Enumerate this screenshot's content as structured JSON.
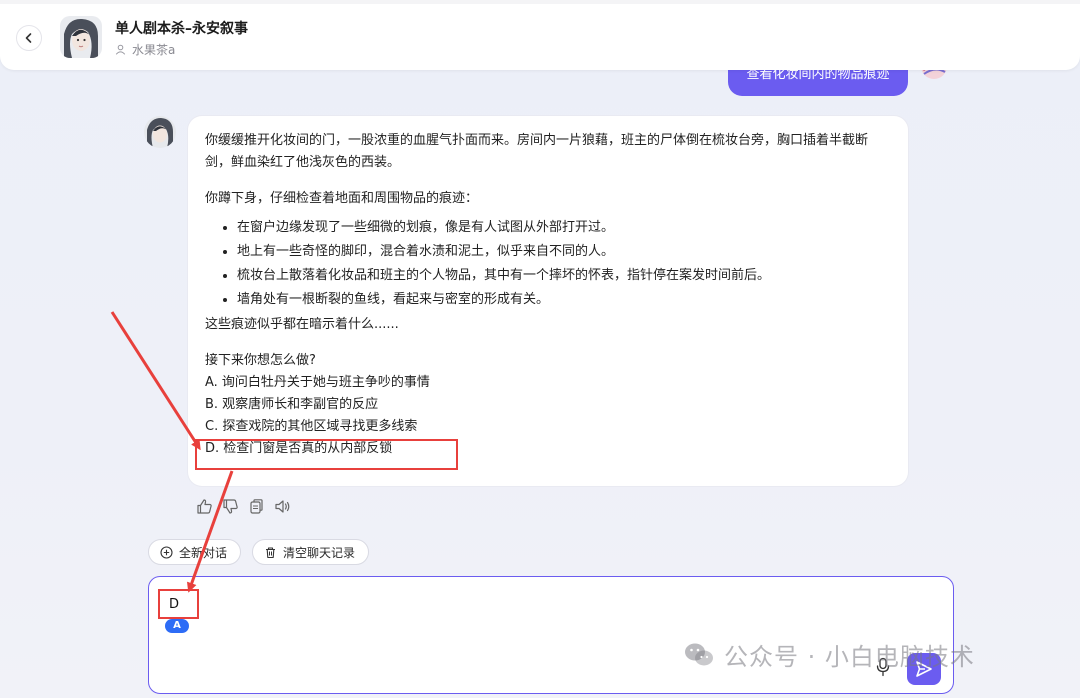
{
  "header": {
    "title": "单人剧本杀–永安叙事",
    "author": "水果茶a"
  },
  "chat": {
    "user_message": "查看化妆间内的物品痕迹",
    "bot_message": {
      "paragraph1": "你缓缓推开化妆间的门，一股浓重的血腥气扑面而来。房间内一片狼藉，班主的尸体倒在梳妆台旁，胸口插着半截断剑，鲜血染红了他浅灰色的西装。",
      "paragraph2": "你蹲下身，仔细检查着地面和周围物品的痕迹：",
      "clues": [
        "在窗户边缘发现了一些细微的划痕，像是有人试图从外部打开过。",
        "地上有一些奇怪的脚印，混合着水渍和泥土，似乎来自不同的人。",
        "梳妆台上散落着化妆品和班主的个人物品，其中有一个摔坏的怀表，指针停在案发时间前后。",
        "墙角处有一根断裂的鱼线，看起来与密室的形成有关。"
      ],
      "paragraph3": "这些痕迹似乎都在暗示着什么......",
      "prompt": "接下来你想怎么做?",
      "options": [
        "A. 询问白牡丹关于她与班主争吵的事情",
        "B. 观察唐师长和李副官的反应",
        "C. 探查戏院的其他区域寻找更多线索",
        "D. 检查门窗是否真的从内部反锁"
      ]
    }
  },
  "actions": {
    "new_chat": "全新对话",
    "clear_history": "清空聊天记录"
  },
  "input": {
    "value": "D",
    "badge": "A"
  },
  "watermark": "公众号 · 小白电脑技术",
  "colors": {
    "accent": "#6b5cf0",
    "annotation_red": "#e8403c",
    "badge_blue": "#2d6cf6"
  }
}
